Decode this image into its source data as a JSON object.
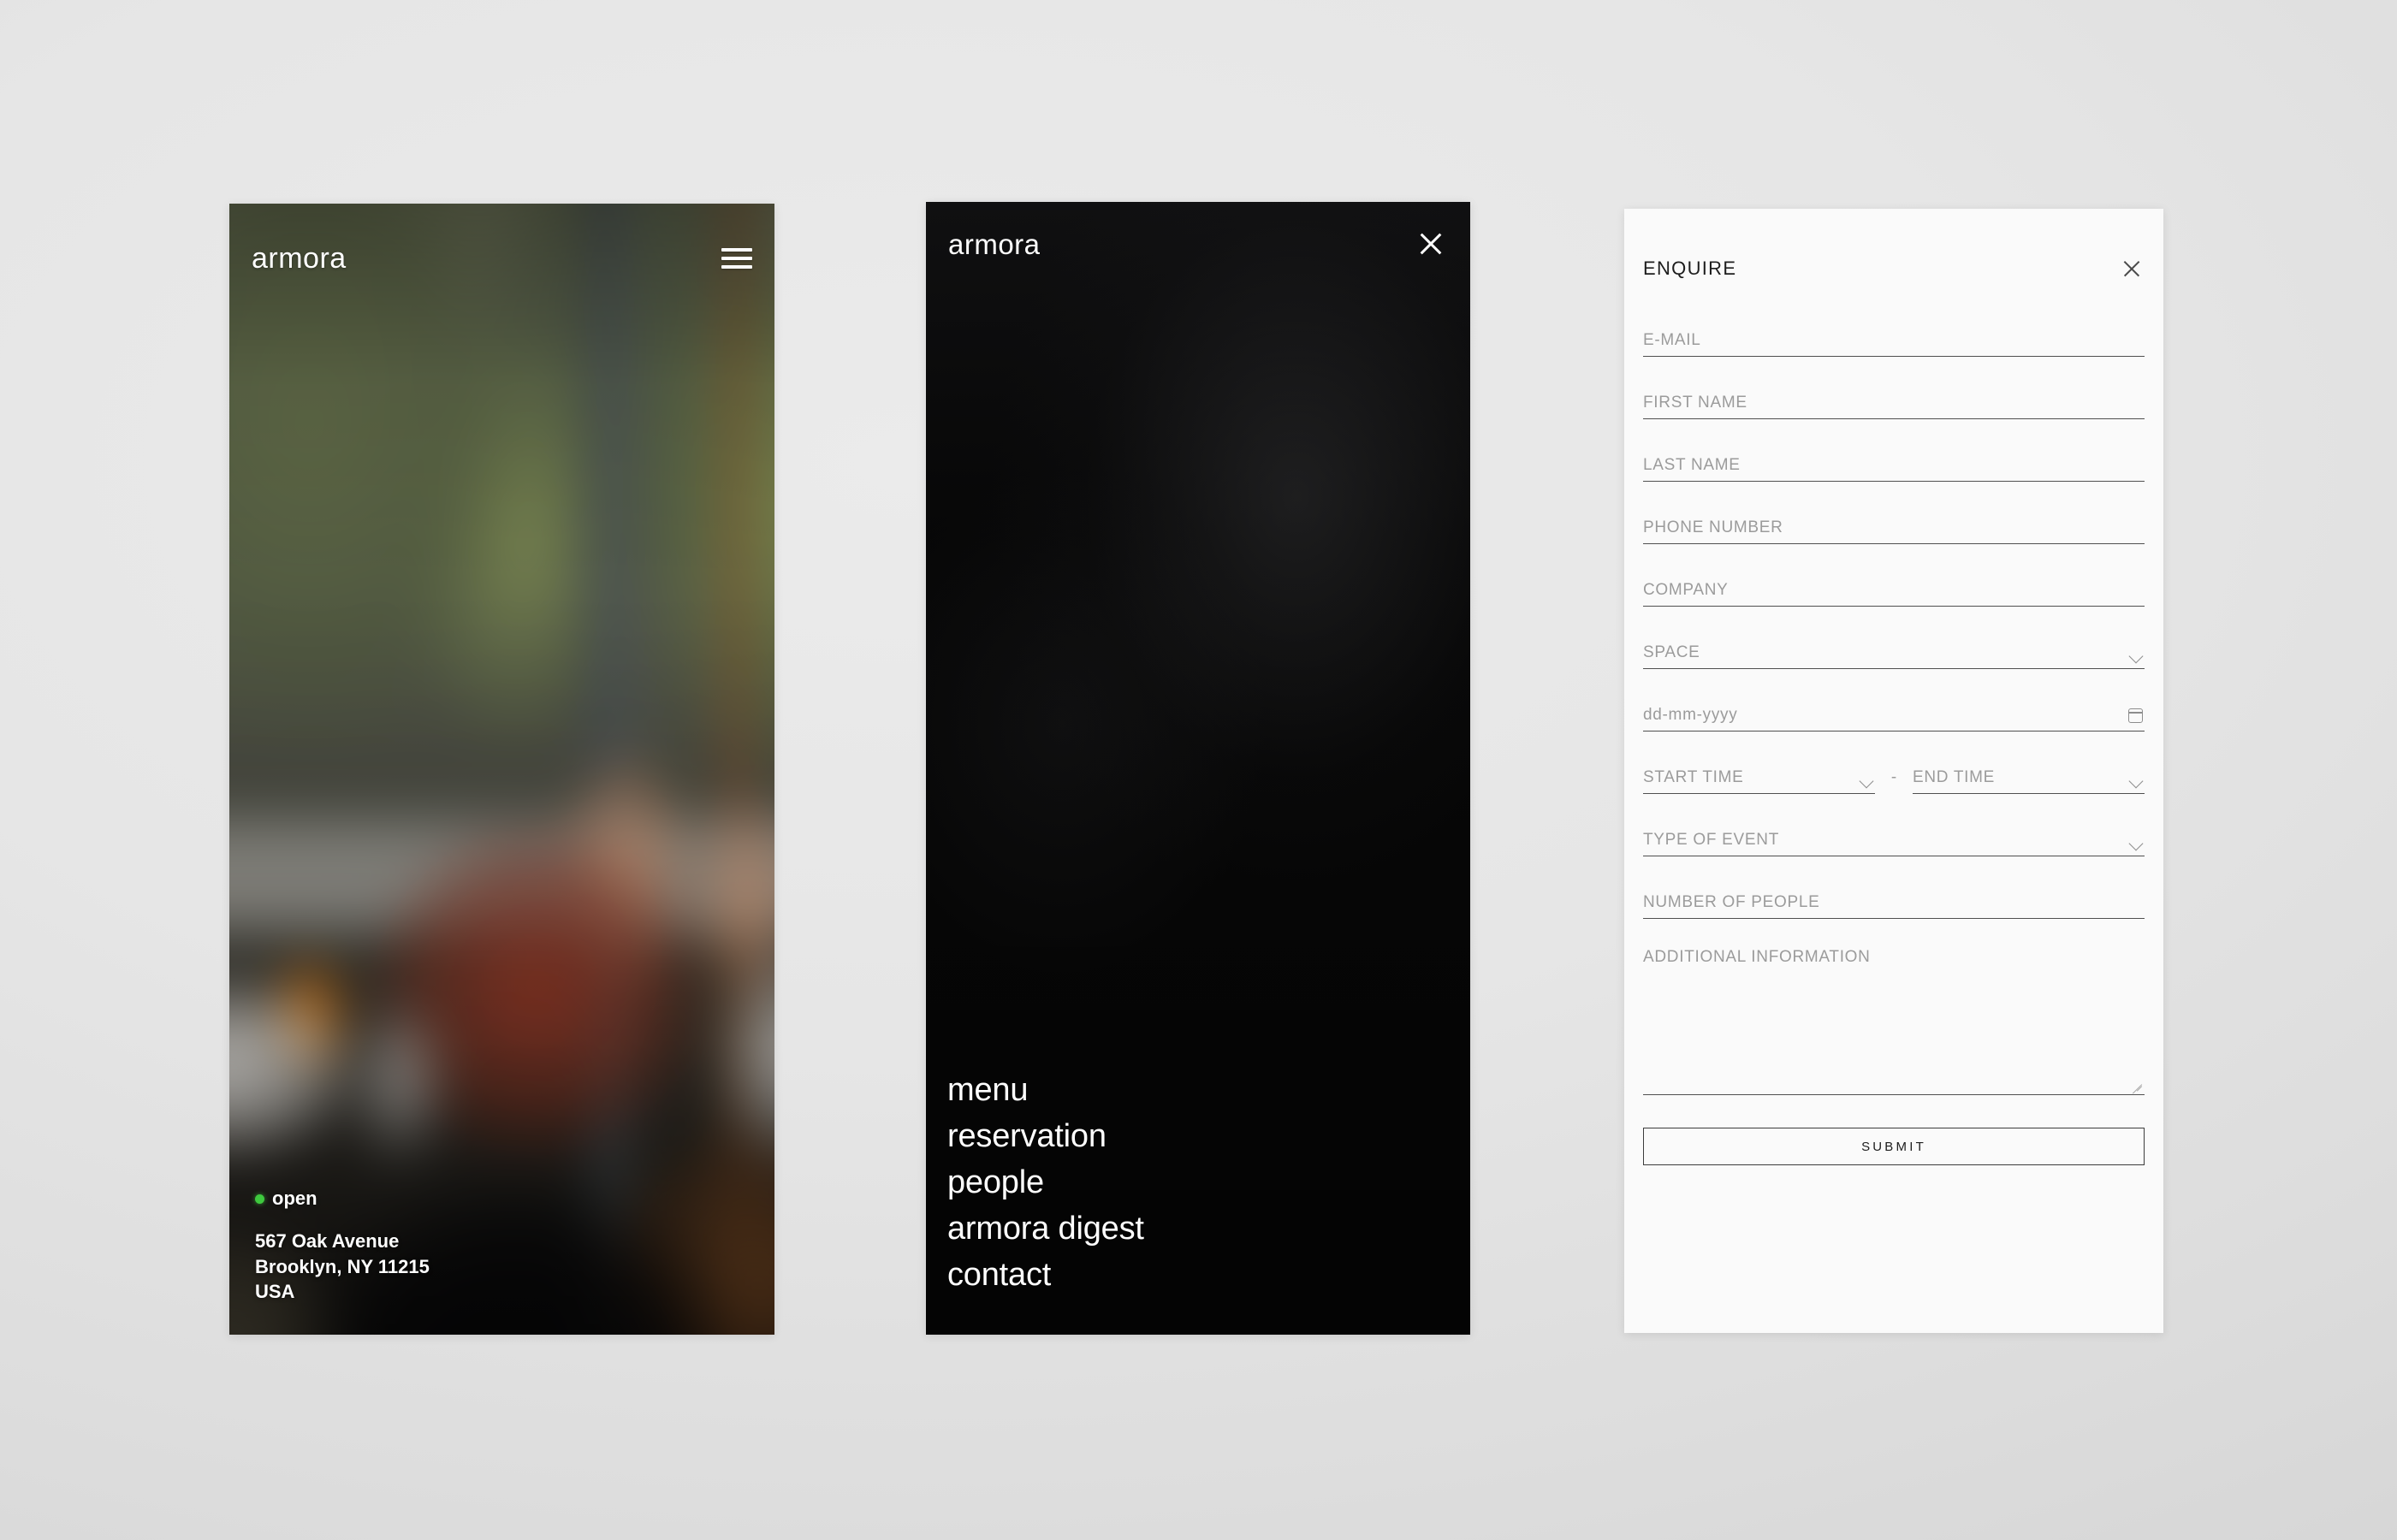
{
  "brand": {
    "wordmark": "armora"
  },
  "hero": {
    "menu_icon": "hamburger-icon",
    "status": {
      "label": "open",
      "dot_color": "#3ec93e"
    },
    "address": {
      "line1": "567 Oak Avenue",
      "line2": "Brooklyn, NY 11215",
      "line3": "USA"
    }
  },
  "nav": {
    "close_icon": "close-icon",
    "items": [
      {
        "label": "menu"
      },
      {
        "label": "reservation"
      },
      {
        "label": "people"
      },
      {
        "label": "armora digest"
      },
      {
        "label": "contact"
      }
    ]
  },
  "enquire": {
    "title": "ENQUIRE",
    "close_icon": "close-icon",
    "fields": {
      "email": {
        "placeholder": "E-MAIL",
        "value": ""
      },
      "first_name": {
        "placeholder": "FIRST NAME",
        "value": ""
      },
      "last_name": {
        "placeholder": "LAST NAME",
        "value": ""
      },
      "phone": {
        "placeholder": "PHONE NUMBER",
        "value": ""
      },
      "company": {
        "placeholder": "COMPANY",
        "value": ""
      },
      "space": {
        "placeholder": "SPACE",
        "value": ""
      },
      "date": {
        "placeholder": "dd-mm-yyyy",
        "value": ""
      },
      "start_time": {
        "placeholder": "START TIME",
        "value": ""
      },
      "time_separator": "-",
      "end_time": {
        "placeholder": "END TIME",
        "value": ""
      },
      "event_type": {
        "placeholder": "TYPE OF EVENT",
        "value": ""
      },
      "people_count": {
        "placeholder": "NUMBER OF PEOPLE",
        "value": ""
      },
      "additional_info": {
        "placeholder": "ADDITIONAL INFORMATION",
        "value": ""
      }
    },
    "submit_label": "SUBMIT"
  }
}
